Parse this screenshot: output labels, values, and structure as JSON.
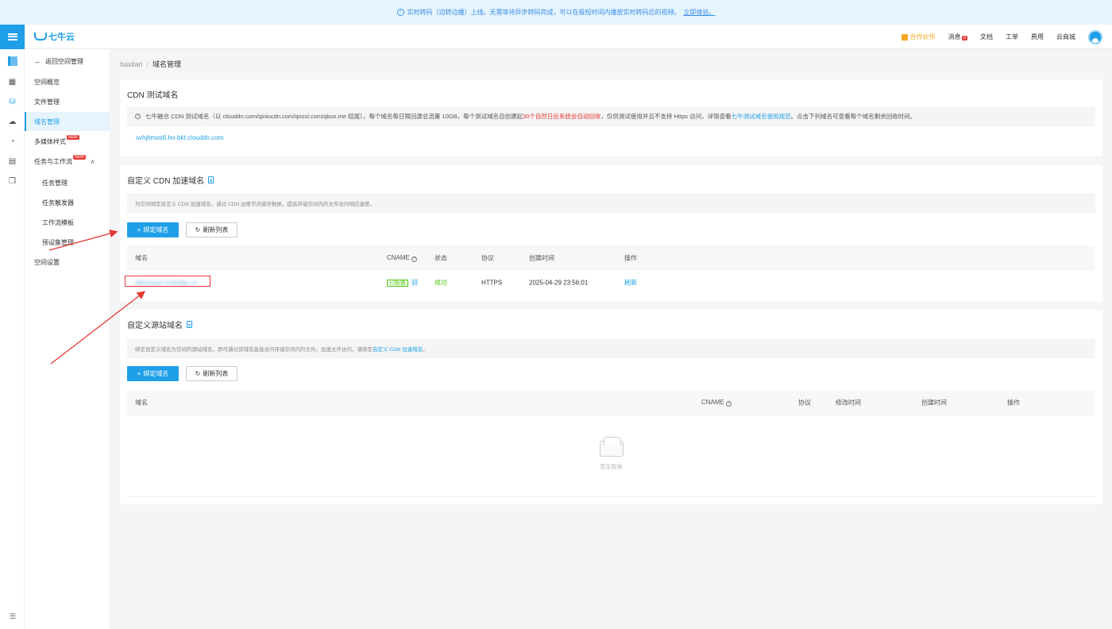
{
  "banner": {
    "text": "实时转码（边转边播）上线。无需等待异步转码完成，可以在极短时间内播放实时转码后的视频。",
    "link": "立即体验。"
  },
  "header": {
    "logo": "七牛云",
    "partner": "合作伙伴",
    "messages": "消息",
    "message_count": "3",
    "docs": "文档",
    "tickets": "工单",
    "billing": "费用",
    "marketplace": "云商城"
  },
  "sidebar": {
    "back": "返回空间管理",
    "items": [
      "空间概览",
      "文件管理",
      "域名管理",
      "多媒体样式",
      "任务与工作流",
      "任务管理",
      "任务触发器",
      "工作流模板",
      "预设集管理",
      "空间设置"
    ],
    "new_badge": "NEW"
  },
  "breadcrumb": {
    "bucket": "baxilan",
    "sep": "/",
    "current": "域名管理"
  },
  "test_domain": {
    "title": "CDN 测试域名",
    "notice_pre": "七牛融合 CDN 测试域名（以 clouddn.com/qiniucdn.com/qnssl.com/qbox.me 结尾），每个域名每日限回源总流量 10GB，每个测试域名自创建起",
    "notice_red": "30个自然日后系统会自动回收",
    "notice_mid": "，仅供测试使用并且不支持 Https 访问，详情查看",
    "notice_link": "七牛测试域名使用规范",
    "notice_post": "。点击下列域名可查看每个域名剩余回收时间。",
    "domain": "svhjhmos6.hn-bkt.clouddn.com"
  },
  "cdn_domain": {
    "title": "自定义 CDN 加速域名",
    "desc": "为空间绑定自定义 CDN 加速域名，通过 CDN 边缘节点缓存数据，提高存储空间内的文件访问响应速度。",
    "bind_btn": "绑定域名",
    "refresh_btn": "刷新列表",
    "columns": [
      "域名",
      "CNAME",
      "状态",
      "协议",
      "创建时间",
      "操作"
    ],
    "row": {
      "domain": "dbmsoqer.hnlaidgn.cn",
      "cname": "已配置",
      "status": "成功",
      "protocol": "HTTPS",
      "created": "2025-04-29 23:56:01",
      "action": "刷新"
    }
  },
  "origin_domain": {
    "title": "自定义源站域名",
    "desc_pre": "绑定自定义域名为空间的源站域名，即可通过该域名直接访问存储空间内的文件。加速文件访问，请绑定",
    "desc_link": "自定义 CDN 加速域名",
    "desc_post": "。",
    "bind_btn": "绑定域名",
    "refresh_btn": "刷新列表",
    "columns": [
      "域名",
      "CNAME",
      "协议",
      "修改时间",
      "创建时间",
      "操作"
    ],
    "empty": "暂无数据"
  },
  "colors": {
    "accent": "#1e9fe8",
    "success": "#52c41a",
    "danger": "#e53935"
  }
}
